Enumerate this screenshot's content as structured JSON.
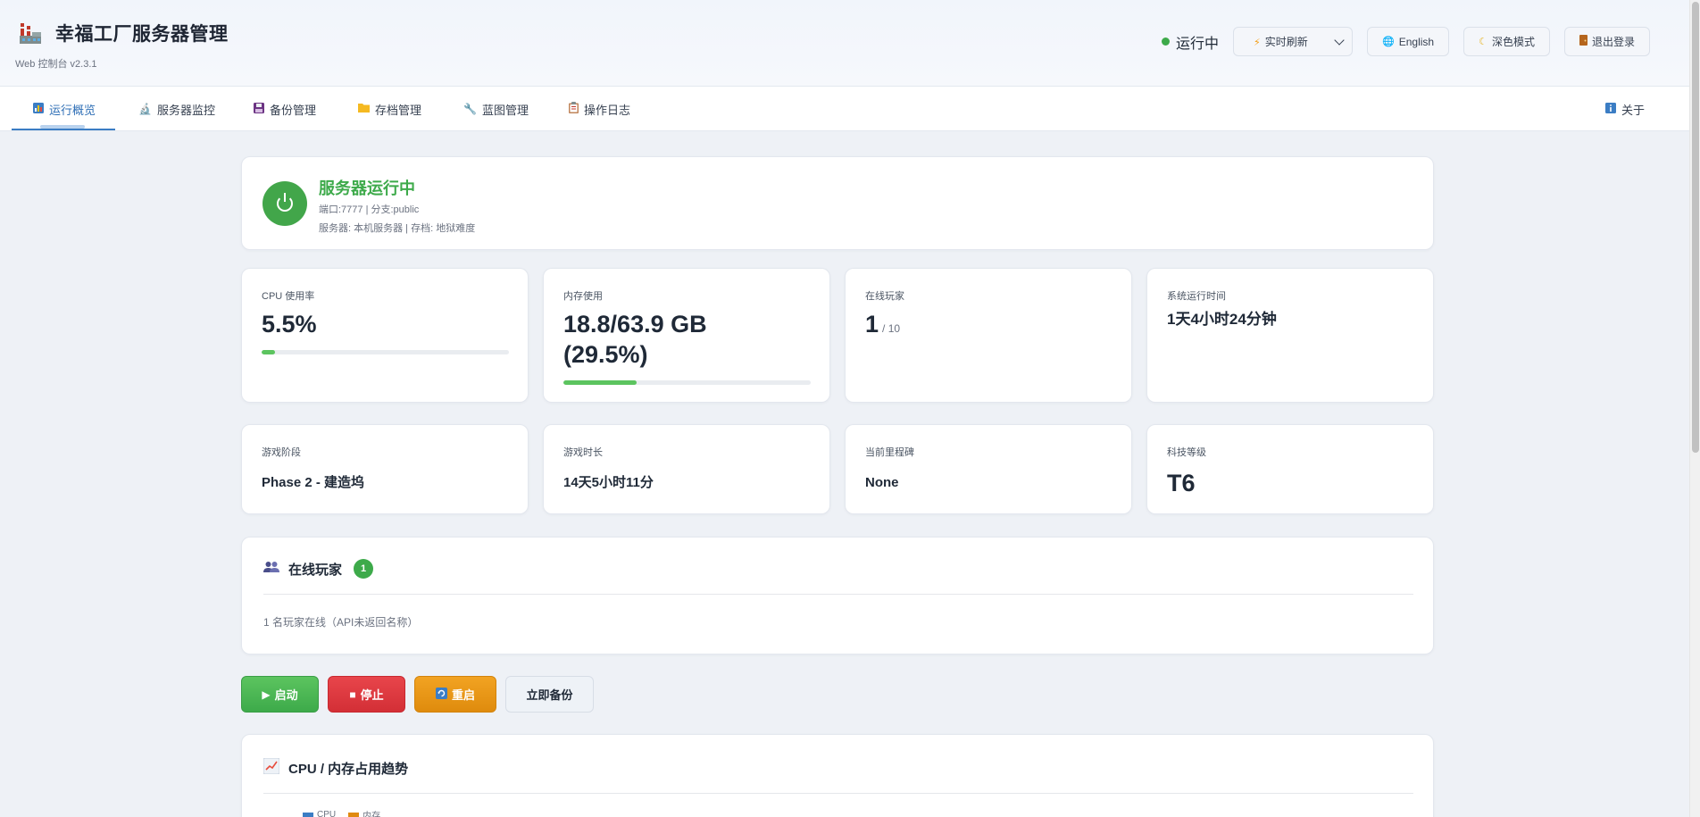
{
  "header": {
    "title": "幸福工厂服务器管理",
    "version": "Web 控制台 v2.3.1",
    "status_text": "运行中",
    "refresh_label": "实时刷新",
    "language_label": "English",
    "theme_label": "深色模式",
    "logout_label": "退出登录"
  },
  "nav": {
    "tabs": [
      {
        "label": "运行概览",
        "icon": "chart-icon",
        "active": true
      },
      {
        "label": "服务器监控",
        "icon": "microscope-icon"
      },
      {
        "label": "备份管理",
        "icon": "floppy-icon"
      },
      {
        "label": "存档管理",
        "icon": "folder-icon"
      },
      {
        "label": "蓝图管理",
        "icon": "wrench-icon"
      },
      {
        "label": "操作日志",
        "icon": "clipboard-icon"
      }
    ],
    "about_label": "关于"
  },
  "server": {
    "title": "服务器运行中",
    "line1": "端口:7777 | 分支:public",
    "line2": "服务器: 本机服务器 | 存档: 地狱难度"
  },
  "metrics": {
    "cpu": {
      "label": "CPU 使用率",
      "value": "5.5%",
      "percent": 5.5
    },
    "memory": {
      "label": "内存使用",
      "value_line1": "18.8/63.9 GB",
      "value_line2": "(29.5%)",
      "percent": 29.5
    },
    "players": {
      "label": "在线玩家",
      "value": "1",
      "max": "/ 10"
    },
    "uptime": {
      "label": "系统运行时间",
      "value": "1天4小时24分钟"
    },
    "phase": {
      "label": "游戏阶段",
      "value": "Phase 2 - 建造坞"
    },
    "playtime": {
      "label": "游戏时长",
      "value": "14天5小时11分"
    },
    "milestone": {
      "label": "当前里程碑",
      "value": "None"
    },
    "tech": {
      "label": "科技等级",
      "value": "T6"
    }
  },
  "players_section": {
    "title": "在线玩家",
    "count": "1",
    "text": "1 名玩家在线（API未返回名称）"
  },
  "actions": {
    "start": "启动",
    "stop": "停止",
    "restart": "重启",
    "backup": "立即备份"
  },
  "trend": {
    "title": "CPU / 内存占用趋势",
    "legend": [
      {
        "name": "CPU",
        "color": "#3b7dc4"
      },
      {
        "name": "内存",
        "color": "#e08a10"
      }
    ]
  },
  "colors": {
    "accent": "#2f6fb6",
    "success": "#3daa4a",
    "danger": "#d32f36",
    "warning": "#df8b0d"
  }
}
